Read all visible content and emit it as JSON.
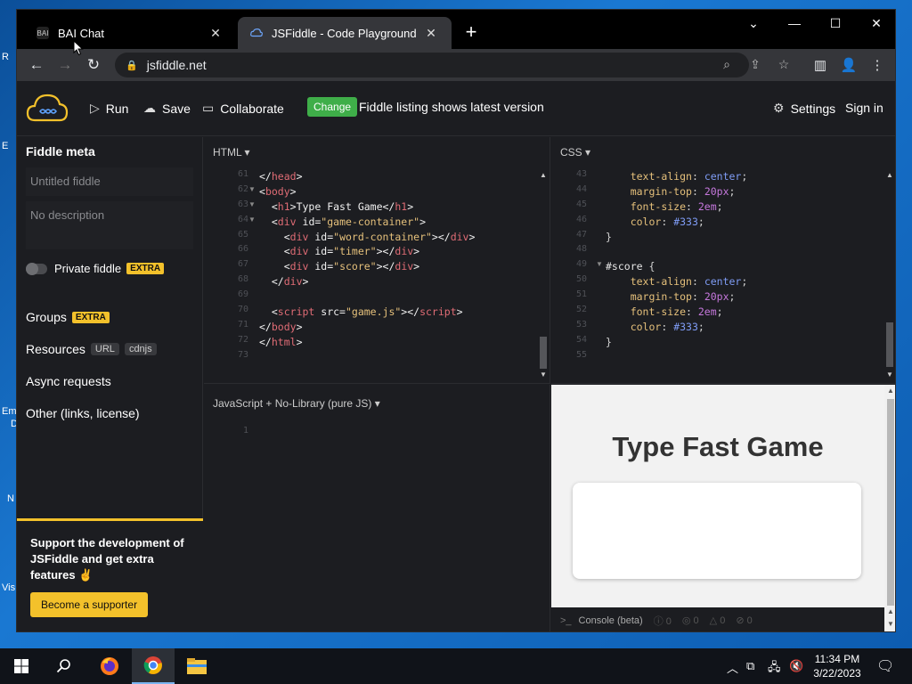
{
  "desktop": {
    "labels": [
      "R",
      "E",
      "Em",
      "D",
      "N",
      "Vis"
    ]
  },
  "browser": {
    "tabs": [
      {
        "title": "BAI Chat",
        "active": false,
        "favicon": "bai-favicon"
      },
      {
        "title": "JSFiddle - Code Playground",
        "active": true,
        "favicon": "jsfiddle-favicon"
      }
    ],
    "address": "jsfiddle.net"
  },
  "header": {
    "run": "Run",
    "save": "Save",
    "collaborate": "Collaborate",
    "change_badge": "Change",
    "listing_text": "Fiddle listing shows latest version",
    "settings": "Settings",
    "sign_in": "Sign in"
  },
  "sidebar": {
    "title": "Fiddle meta",
    "name_placeholder": "Untitled fiddle",
    "description_placeholder": "No description",
    "private_label": "Private fiddle",
    "extra": "EXTRA",
    "groups": "Groups",
    "resources": "Resources",
    "url_tag": "URL",
    "cdnjs_tag": "cdnjs",
    "async": "Async requests",
    "other": "Other (links, license)",
    "support_text": "Support the development of JSFiddle and get extra features ✌",
    "support_button": "Become a supporter"
  },
  "html_panel": {
    "label": "HTML ▾",
    "line_numbers": [
      "61",
      "62",
      "63",
      "64",
      "65",
      "66",
      "67",
      "68",
      "69",
      "70",
      "71",
      "72",
      "73"
    ]
  },
  "css_panel": {
    "label": "CSS ▾",
    "line_numbers": [
      "43",
      "44",
      "45",
      "46",
      "47",
      "48",
      "49",
      "50",
      "51",
      "52",
      "53",
      "54",
      "55"
    ]
  },
  "js_panel": {
    "label": "JavaScript + No-Library (pure JS) ▾",
    "line_numbers": [
      "1"
    ]
  },
  "result": {
    "game_title": "Type Fast Game",
    "console_label": "Console (beta)",
    "counts": [
      "0",
      "0",
      "0",
      "0"
    ]
  },
  "taskbar": {
    "time": "11:34 PM",
    "date": "3/22/2023"
  }
}
